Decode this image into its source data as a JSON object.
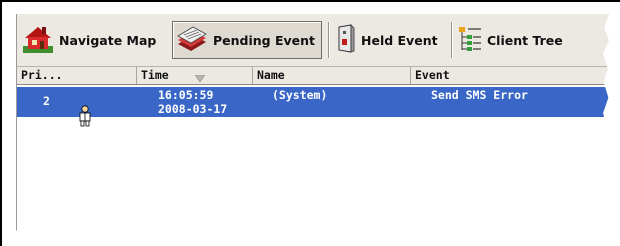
{
  "toolbar": {
    "navigate_map": "Navigate Map",
    "pending_event": "Pending Event",
    "held_event": "Held Event",
    "client_tree": "Client Tree",
    "icons": {
      "navigate_map": "house-icon",
      "pending_event": "stack-of-documents-icon",
      "held_event": "held-door-icon",
      "client_tree": "tree-list-icon"
    }
  },
  "table": {
    "headers": {
      "priority": "Pri...",
      "time": "Time",
      "name": "Name",
      "event": "Event"
    },
    "rows": [
      {
        "priority": "2",
        "time": "16:05:59",
        "date": "2008-03-17",
        "name": "(System)",
        "event": "Send SMS Error",
        "icon": "person-icon",
        "selected": true
      }
    ]
  },
  "colors": {
    "selection": "#3a67c7",
    "toolbar_bg": "#ece9e3"
  }
}
